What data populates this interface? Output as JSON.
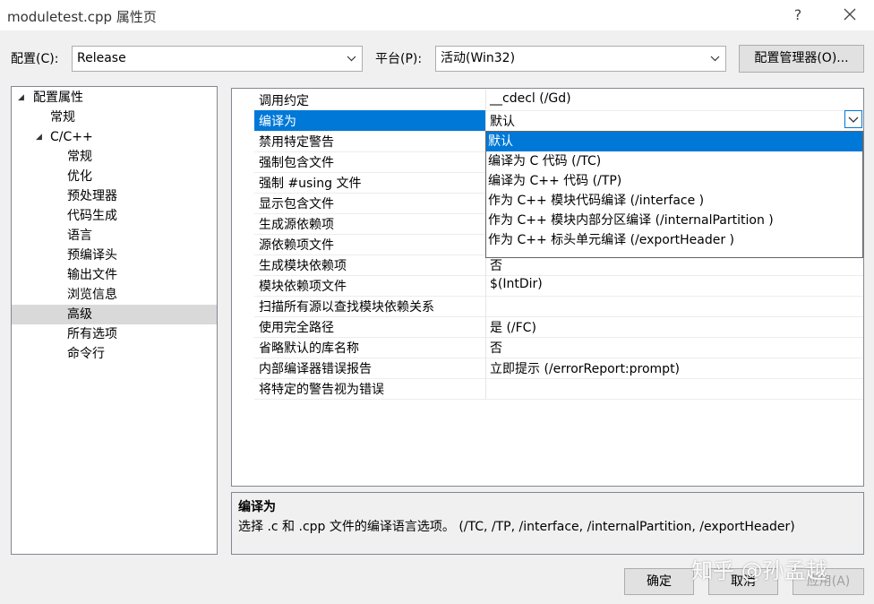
{
  "window": {
    "title": "moduletest.cpp 属性页",
    "help_label": "?",
    "close_icon": "close-icon"
  },
  "config_row": {
    "config_label": "配置(C):",
    "config_value": "Release",
    "platform_label": "平台(P):",
    "platform_value": "活动(Win32)",
    "config_manager_label": "配置管理器(O)..."
  },
  "tree": {
    "items": [
      {
        "label": "配置属性",
        "expanded": true
      },
      {
        "label": "常规"
      },
      {
        "label": "C/C++",
        "expanded": true
      },
      {
        "label": "常规"
      },
      {
        "label": "优化"
      },
      {
        "label": "预处理器"
      },
      {
        "label": "代码生成"
      },
      {
        "label": "语言"
      },
      {
        "label": "预编译头"
      },
      {
        "label": "输出文件"
      },
      {
        "label": "浏览信息"
      },
      {
        "label": "高级",
        "selected": true
      },
      {
        "label": "所有选项"
      },
      {
        "label": "命令行"
      }
    ]
  },
  "grid": {
    "rows": [
      {
        "name": "调用约定",
        "value": "__cdecl (/Gd)"
      },
      {
        "name": "编译为",
        "value": "默认",
        "selected": true
      },
      {
        "name": "禁用特定警告",
        "value": ""
      },
      {
        "name": "强制包含文件",
        "value": ""
      },
      {
        "name": "强制 #using 文件",
        "value": ""
      },
      {
        "name": "显示包含文件",
        "value": ""
      },
      {
        "name": "生成源依赖项",
        "value": ""
      },
      {
        "name": "源依赖项文件",
        "value": ""
      },
      {
        "name": "生成模块依赖项",
        "value": "否"
      },
      {
        "name": "模块依赖项文件",
        "value": "$(IntDir)"
      },
      {
        "name": "扫描所有源以查找模块依赖关系",
        "value": ""
      },
      {
        "name": "使用完全路径",
        "value": "是 (/FC)"
      },
      {
        "name": "省略默认的库名称",
        "value": "否"
      },
      {
        "name": "内部编译器错误报告",
        "value": "立即提示 (/errorReport:prompt)"
      },
      {
        "name": "将特定的警告视为错误",
        "value": ""
      }
    ]
  },
  "dropdown": {
    "options": [
      {
        "label": "默认",
        "selected": true
      },
      {
        "label": "编译为 C 代码 (/TC)"
      },
      {
        "label": "编译为 C++ 代码 (/TP)"
      },
      {
        "label": "作为 C++ 模块代码编译 (/interface )"
      },
      {
        "label": "作为 C++ 模块内部分区编译 (/internalPartition )"
      },
      {
        "label": "作为 C++ 标头单元编译 (/exportHeader )"
      }
    ]
  },
  "description": {
    "title": "编译为",
    "text": "选择 .c 和 .cpp 文件的编译语言选项。     (/TC, /TP, /interface, /internalPartition, /exportHeader)"
  },
  "buttons": {
    "ok": "确定",
    "cancel": "取消",
    "apply": "应用(A)"
  },
  "watermark": "知乎 @孙孟越",
  "colors": {
    "selection": "#0078d7",
    "tree_selection": "#d9d9d9"
  }
}
